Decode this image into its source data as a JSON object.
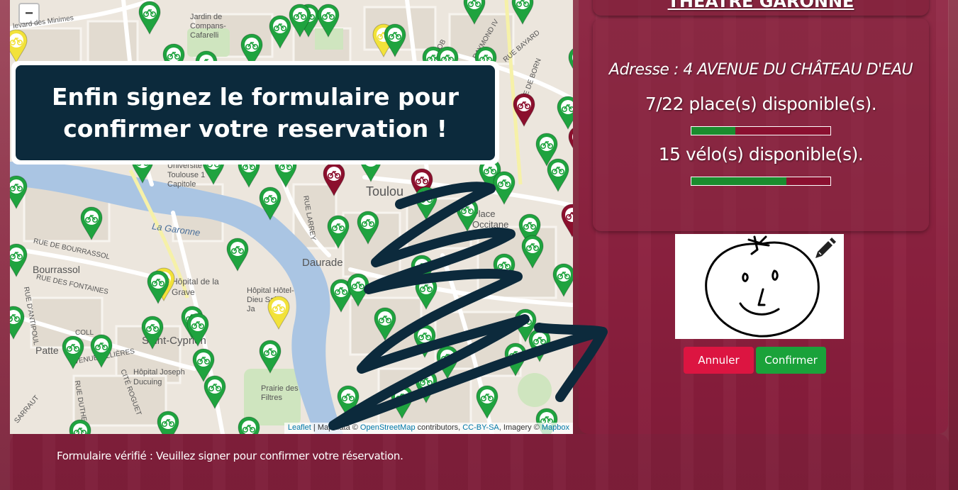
{
  "map": {
    "zoom_out_label": "−",
    "attribution": {
      "leaflet": "Leaflet",
      "sep1": " | Map data © ",
      "osm": "OpenStreetMap",
      "contributors": " contributors, ",
      "license": "CC-BY-SA",
      "imagery": ", Imagery © ",
      "mapbox": "Mapbox"
    },
    "labels": {
      "garonne": "La Garonne",
      "bourrassol": "Bourrassol",
      "daurade": "Daurade",
      "toulouse": "Toulou",
      "place_occitane": "Place\nOccitane",
      "hopital_grave": "Hôpital de la\nGrave",
      "hotel_dieu": "Hôpital Hôtel-\nDieu Saint-\nJa",
      "st_cyprien": "Saint-Cyprien",
      "patte_oie": "Patte",
      "hopital_ducuing": "Hôpital Joseph\nDucuing",
      "prairie_filtres": "Prairie des\nFiltres",
      "universite": "Université\nToulouse 1\nCapitole",
      "jardin_compans": "Jardin de\nCompans-\nCafarelli",
      "rue_bourrassol": "RUE DE BOURRASSOL",
      "rue_fontaines": "RUE DES FONTAINES",
      "avenue_lilleres": "AVENUE LILLIÈRES",
      "rue_larrey": "RUE LARREY",
      "bd_minimes": "levard des Minimes",
      "rue_bayard": "RUE BAYARD",
      "raymond_iv": "RAYMOND IV",
      "rue_job": "RUE JOB",
      "rue_born": "RUE DE BORN",
      "cite_roguet": "CITÉ ROGUET",
      "rue_antipoul": "RUE D'ANTIPOUL",
      "rue_duthe": "RUE DUTHE",
      "sarraut": "SARRAUT",
      "coll": "COLL"
    }
  },
  "tutorial": {
    "message": "Enfin signez le formulaire pour confirmer votre reservation !"
  },
  "station": {
    "name": "THÉATRE GARONNE",
    "address": "Adresse : 4 AVENUE DU CHÂTEAU D'EAU",
    "places_text": "7/22 place(s) disponible(s).",
    "places_available": 7,
    "places_total": 22,
    "bikes_text": "15 vélo(s) disponible(s).",
    "bikes_available": 15,
    "bikes_total": 22
  },
  "signature": {
    "pencil_icon": "pencil-icon"
  },
  "buttons": {
    "cancel": "Annuler",
    "confirm": "Confirmer"
  },
  "footer": {
    "status": "Formulaire vérifié : Veuillez signer pour confirmer votre réservation."
  },
  "colors": {
    "marker_green": "#1fa33f",
    "marker_red": "#8b0f2d",
    "marker_yellow": "#f2e23a",
    "tutorial_bg": "#0c2a3c",
    "confirm": "#1aa23a",
    "cancel": "#dc1541"
  }
}
